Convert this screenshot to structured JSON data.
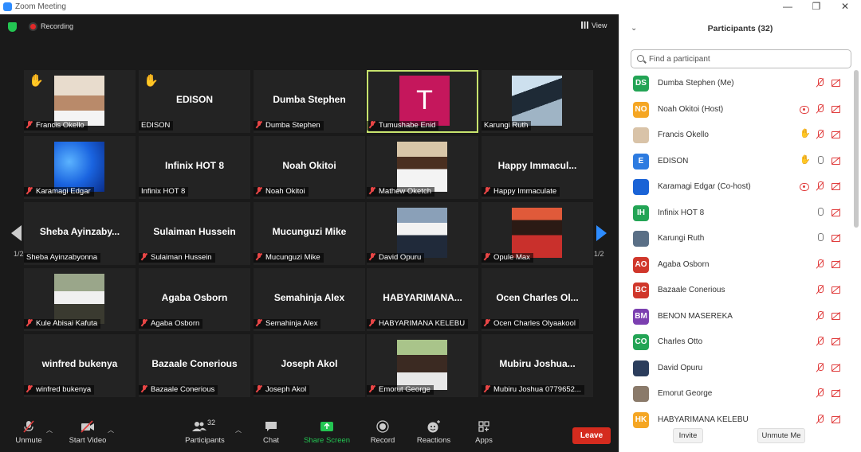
{
  "window": {
    "title": "Zoom Meeting",
    "minimize": "—",
    "restore": "❐",
    "close": "✕"
  },
  "topbar": {
    "recording_label": "Recording",
    "view_label": "View"
  },
  "tiles": [
    {
      "big": "",
      "name": "Francis Okello",
      "muted": true,
      "hand": true,
      "image": "photo-priest"
    },
    {
      "big": "EDISON",
      "name": "EDISON",
      "muted": false,
      "hand": true
    },
    {
      "big": "Dumba Stephen",
      "name": "Dumba Stephen",
      "muted": true
    },
    {
      "big": "",
      "letter": "T",
      "name": "Tumushabe Enid",
      "muted": true,
      "active": true
    },
    {
      "big": "",
      "name": "Karungi Ruth",
      "muted": false,
      "image": "photo-penguins"
    },
    {
      "big": "",
      "name": "Karamagi Edgar",
      "muted": true,
      "image": "photo-windows"
    },
    {
      "big": "Infinix HOT 8",
      "name": "Infinix HOT 8",
      "muted": false
    },
    {
      "big": "Noah Okitoi",
      "name": "Noah Okitoi",
      "muted": true
    },
    {
      "big": "",
      "name": "Mathew Oketch",
      "muted": true,
      "image": "photo-man-white-shirt"
    },
    {
      "big": "Happy  Immacul...",
      "name": "Happy Immaculate",
      "muted": true
    },
    {
      "big": "Sheba  Ayinzaby...",
      "name": "Sheba Ayinzabyonna",
      "muted": false
    },
    {
      "big": "Sulaiman Hussein",
      "name": "Sulaiman Hussein",
      "muted": true
    },
    {
      "big": "Mucunguzi Mike",
      "name": "Mucunguzi Mike",
      "muted": true
    },
    {
      "big": "",
      "name": "David Opuru",
      "muted": true,
      "image": "photo-group"
    },
    {
      "big": "",
      "name": "Opule Max",
      "muted": true,
      "image": "photo-man-mask"
    },
    {
      "big": "",
      "name": "Kule Abisai Kafuta",
      "muted": true,
      "image": "photo-group2"
    },
    {
      "big": "Agaba Osborn",
      "name": "Agaba Osborn",
      "muted": true
    },
    {
      "big": "Semahinja Alex",
      "name": "Semahinja Alex",
      "muted": true
    },
    {
      "big": "HABYARIMANA...",
      "name": "HABYARIMANA KELEBU",
      "muted": true
    },
    {
      "big": "Ocen  Charles  Ol...",
      "name": "Ocen Charles Olyaakool",
      "muted": true
    },
    {
      "big": "winfred bukenya",
      "name": "winfred bukenya",
      "muted": true
    },
    {
      "big": "Bazaale Conerious",
      "name": "Bazaale Conerious",
      "muted": true
    },
    {
      "big": "Joseph Akol",
      "name": "Joseph Akol",
      "muted": true
    },
    {
      "big": "",
      "name": "Emorut George",
      "muted": true,
      "image": "photo-man-outdoor"
    },
    {
      "big": "Mubiru  Joshua...",
      "name": "Mubiru Joshua 0779652...",
      "muted": true
    }
  ],
  "pager": {
    "left": "1/2",
    "right": "1/2"
  },
  "toolbar": {
    "unmute": "Unmute",
    "start_video": "Start Video",
    "participants": "Participants",
    "participants_count": "32",
    "chat": "Chat",
    "share_screen": "Share Screen",
    "record": "Record",
    "reactions": "Reactions",
    "apps": "Apps",
    "leave": "Leave"
  },
  "panel": {
    "title": "Participants (32)",
    "search_placeholder": "Find a participant",
    "invite": "Invite",
    "unmute_me": "Unmute Me",
    "participants": [
      {
        "initials": "DS",
        "color": "#23a455",
        "name": "Dumba Stephen (Me)",
        "icons": [
          "mic-m",
          "vid-m"
        ]
      },
      {
        "initials": "NO",
        "color": "#f5a623",
        "name": "Noah Okitoi (Host)",
        "icons": [
          "rec-i",
          "mic-m",
          "vid-m"
        ]
      },
      {
        "initials": "",
        "color": "#d9c3a8",
        "name": "Francis Okello",
        "icons": [
          "hand-i",
          "mic-m",
          "vid-m"
        ]
      },
      {
        "initials": "E",
        "color": "#2d7be0",
        "name": "EDISON",
        "icons": [
          "hand-i",
          "mic-on",
          "vid-m"
        ]
      },
      {
        "initials": "",
        "color": "#1a63d6",
        "name": "Karamagi Edgar (Co-host)",
        "icons": [
          "rec-i",
          "mic-m",
          "vid-m"
        ]
      },
      {
        "initials": "IH",
        "color": "#23a455",
        "name": "Infinix HOT 8",
        "icons": [
          "mic-on",
          "vid-m"
        ]
      },
      {
        "initials": "",
        "color": "#5a6f86",
        "name": "Karungi Ruth",
        "icons": [
          "mic-on",
          "vid-m"
        ]
      },
      {
        "initials": "AO",
        "color": "#d0372b",
        "name": "Agaba Osborn",
        "icons": [
          "mic-m",
          "vid-m"
        ]
      },
      {
        "initials": "BC",
        "color": "#d0372b",
        "name": "Bazaale Conerious",
        "icons": [
          "mic-m",
          "vid-m"
        ]
      },
      {
        "initials": "BM",
        "color": "#7b3fb0",
        "name": "BENON MASEREKA",
        "icons": [
          "mic-m",
          "vid-m"
        ]
      },
      {
        "initials": "CO",
        "color": "#23a455",
        "name": "Charles Otto",
        "icons": [
          "mic-m",
          "vid-m"
        ]
      },
      {
        "initials": "",
        "color": "#2b3d5c",
        "name": "David Opuru",
        "icons": [
          "mic-m",
          "vid-m"
        ]
      },
      {
        "initials": "",
        "color": "#8a7a6a",
        "name": "Emorut George",
        "icons": [
          "mic-m",
          "vid-m"
        ]
      },
      {
        "initials": "HK",
        "color": "#f5a623",
        "name": "HABYARIMANA KELEBU",
        "icons": [
          "mic-m",
          "vid-m"
        ]
      }
    ]
  }
}
